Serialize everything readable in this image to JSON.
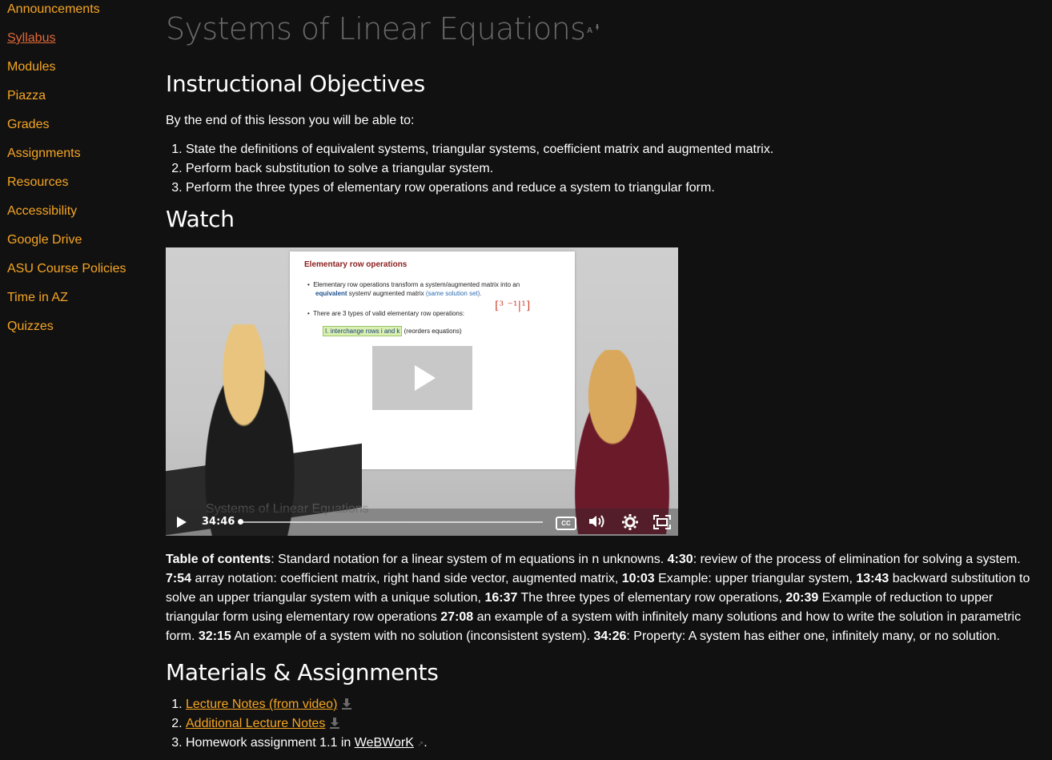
{
  "sidebar": {
    "items": [
      {
        "label": "Announcements"
      },
      {
        "label": "Syllabus",
        "active": true
      },
      {
        "label": "Modules"
      },
      {
        "label": "Piazza"
      },
      {
        "label": "Grades"
      },
      {
        "label": "Assignments"
      },
      {
        "label": "Resources"
      },
      {
        "label": "Accessibility"
      },
      {
        "label": "Google Drive"
      },
      {
        "label": "ASU Course Policies"
      },
      {
        "label": "Time in AZ"
      },
      {
        "label": "Quizzes"
      }
    ]
  },
  "page": {
    "title": "Systems of Linear Equations"
  },
  "objectives": {
    "heading": "Instructional Objectives",
    "intro": "By the end of this lesson you will be able to:",
    "items": [
      "State the definitions of equivalent systems, triangular systems, coefficient matrix and augmented matrix.",
      "Perform back substitution to solve a triangular system.",
      "Perform the three types of elementary row operations and reduce a system to triangular form."
    ]
  },
  "watch": {
    "heading": "Watch",
    "video": {
      "slide_title": "Elementary row operations",
      "slide_bullet1_a": "Elementary row operations transform a system/augmented matrix into an",
      "slide_bullet1_b_bold": "equivalent",
      "slide_bullet1_b_rest": " system/ augmented matrix  ",
      "slide_bullet1_b_paren": "(same solution set).",
      "slide_bullet2": "There are 3 types of valid elementary row operations:",
      "slide_box": "I. interchange rows i and k",
      "slide_box_rest": " (reorders equations)",
      "watermark": "Systems of Linear Equations",
      "time": "34:46",
      "progress": 0.0
    }
  },
  "toc": {
    "label": "Table of contents",
    "intro": ": Standard notation for a linear system of m equations in n unknowns. ",
    "entries": [
      {
        "time": "4:30",
        "text": ": review of the process of elimination for solving a system. "
      },
      {
        "time": "7:54",
        "text": " array notation: coefficient matrix, right hand side vector, augmented matrix, "
      },
      {
        "time": "10:03",
        "text": " Example: upper triangular system, "
      },
      {
        "time": "13:43",
        "text": " backward substitution to solve an upper triangular system with a unique solution, "
      },
      {
        "time": "16:37",
        "text": " The three types of elementary row operations, "
      },
      {
        "time": "20:39",
        "text": " Example of reduction to upper triangular form using elementary row operations "
      },
      {
        "time": "27:08",
        "text": " an example of a system with infinitely many solutions and how to write the solution in parametric form. "
      },
      {
        "time": "32:15",
        "text": " An example of a system with no solution (inconsistent system). "
      },
      {
        "time": "34:26",
        "text": ": Property: A system has either one, infinitely many, or no solution."
      }
    ]
  },
  "materials": {
    "heading": "Materials & Assignments",
    "item1": "Lecture Notes (from video)",
    "item2": "Additional Lecture Notes",
    "item3_prefix": "Homework assignment 1.1 in ",
    "item3_link": "WeBWorK",
    "item3_suffix": "."
  },
  "colors": {
    "background": "#121111",
    "link": "#f5a623",
    "active_link": "#e06838",
    "title": "#6b6b6b"
  }
}
